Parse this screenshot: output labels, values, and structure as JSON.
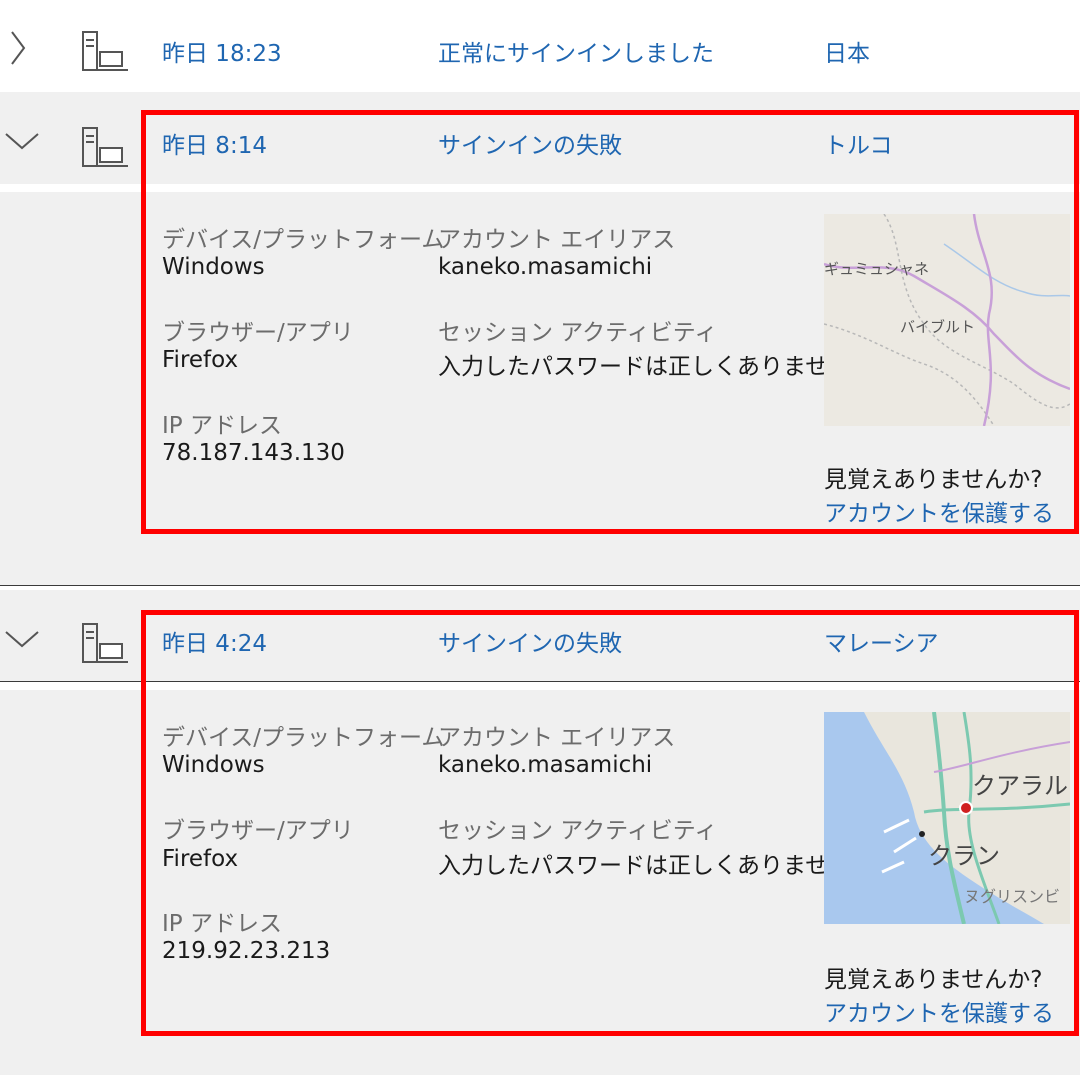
{
  "colors": {
    "link": "#1f66b1",
    "highlight": "#ff0000",
    "panel": "#f0f0f0",
    "label": "#6c6c6c"
  },
  "rows": [
    {
      "icon": "chevron-right-icon",
      "time": "昨日 18:23",
      "status": "正常にサインインしました",
      "location": "日本"
    },
    {
      "icon": "chevron-down-icon",
      "time": "昨日 8:14",
      "status": "サインインの失敗",
      "location": "トルコ",
      "device_label": "デバイス/プラットフォーム",
      "device_value": "Windows",
      "browser_label": "ブラウザー/アプリ",
      "browser_value": "Firefox",
      "ip_label": "IP アドレス",
      "ip_value": "78.187.143.130",
      "alias_label": "アカウント エイリアス",
      "alias_value": "kaneko.masamichi",
      "session_label": "セッション アクティビティ",
      "session_value": "入力したパスワードは正しくありません",
      "unfamiliar": "見覚えありませんか?",
      "protect_link": "アカウントを保護する",
      "map_labels": [
        "ギュミュシャネ",
        "バイブルト"
      ]
    },
    {
      "icon": "chevron-down-icon",
      "time": "昨日 4:24",
      "status": "サインインの失敗",
      "location": "マレーシア",
      "device_label": "デバイス/プラットフォーム",
      "device_value": "Windows",
      "browser_label": "ブラウザー/アプリ",
      "browser_value": "Firefox",
      "ip_label": "IP アドレス",
      "ip_value": "219.92.23.213",
      "alias_label": "アカウント エイリアス",
      "alias_value": "kaneko.masamichi",
      "session_label": "セッション アクティビティ",
      "session_value": "入力したパスワードは正しくありません",
      "unfamiliar": "見覚えありませんか?",
      "protect_link": "アカウントを保護する",
      "map_labels": [
        "クアラル",
        "クラン",
        "ヌグリスンビ"
      ]
    }
  ]
}
